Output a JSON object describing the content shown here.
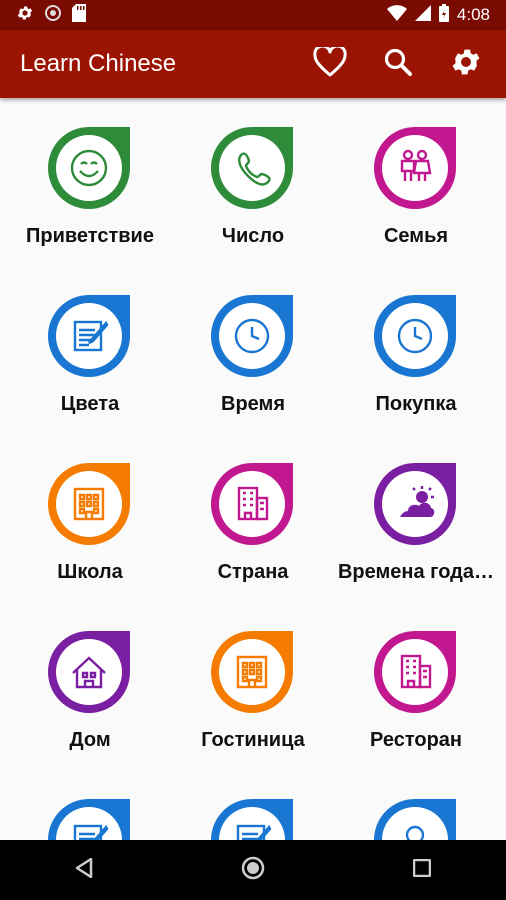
{
  "status_bar": {
    "time": "4:08",
    "icons": [
      "settings-icon",
      "circle-icon",
      "sd-card-icon",
      "wifi-icon",
      "signal-icon",
      "battery-icon"
    ]
  },
  "app_bar": {
    "title": "Learn Chinese",
    "actions": [
      "heart-icon",
      "search-icon",
      "gear-icon"
    ]
  },
  "colors": {
    "status_bar": "#7a0b02",
    "app_bar": "#9b1402",
    "green": "#2e8b3a",
    "blue": "#1976d2",
    "magenta": "#c2188f",
    "orange": "#f57c00",
    "purple": "#7b1fa2"
  },
  "categories": [
    {
      "label": "Приветствие",
      "icon": "smile-icon",
      "color": "#2e8b3a"
    },
    {
      "label": "Число",
      "icon": "phone-icon",
      "color": "#2e8b3a"
    },
    {
      "label": "Семья",
      "icon": "family-icon",
      "color": "#c2188f"
    },
    {
      "label": "Цвета",
      "icon": "notepad-icon",
      "color": "#1976d2"
    },
    {
      "label": "Время",
      "icon": "clock-icon",
      "color": "#1976d2"
    },
    {
      "label": "Покупка",
      "icon": "clock-icon",
      "color": "#1976d2"
    },
    {
      "label": "Школа",
      "icon": "building-icon",
      "color": "#f57c00"
    },
    {
      "label": "Страна",
      "icon": "office-building-icon",
      "color": "#c2188f"
    },
    {
      "label": "Времена года…",
      "icon": "weather-icon",
      "color": "#7b1fa2"
    },
    {
      "label": "Дом",
      "icon": "house-icon",
      "color": "#7b1fa2"
    },
    {
      "label": "Гостиница",
      "icon": "building-icon",
      "color": "#f57c00"
    },
    {
      "label": "Ресторан",
      "icon": "office-building-icon",
      "color": "#c2188f"
    },
    {
      "label": "",
      "icon": "notepad-icon",
      "color": "#1976d2"
    },
    {
      "label": "",
      "icon": "notepad-icon",
      "color": "#1976d2"
    },
    {
      "label": "",
      "icon": "person-icon",
      "color": "#1976d2"
    }
  ],
  "nav_bar": [
    "back-icon",
    "home-icon",
    "recents-icon"
  ]
}
